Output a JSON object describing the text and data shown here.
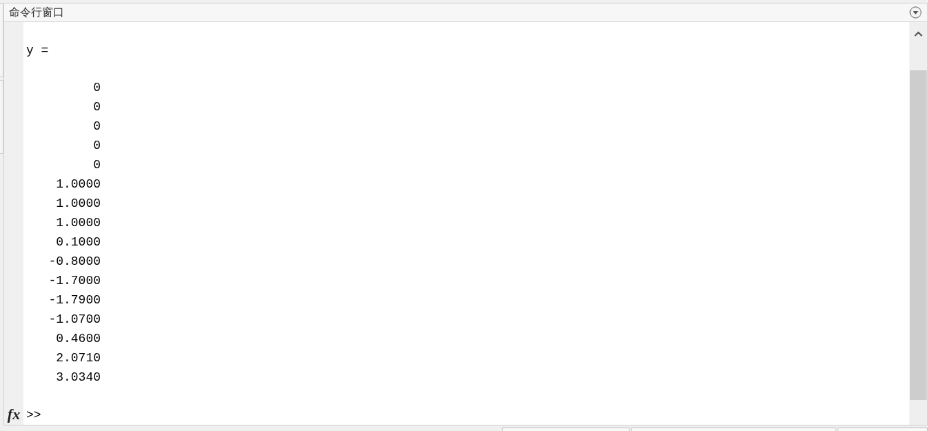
{
  "panel": {
    "title": "命令行窗口"
  },
  "output": {
    "variable_line": "y =",
    "values": [
      "         0",
      "         0",
      "         0",
      "         0",
      "         0",
      "    1.0000",
      "    1.0000",
      "    1.0000",
      "    0.1000",
      "   -0.8000",
      "   -1.7000",
      "   -1.7900",
      "   -1.0700",
      "    0.4600",
      "    2.0710",
      "    3.0340"
    ]
  },
  "prompt": {
    "function_button": "fx",
    "symbol": ">>"
  }
}
